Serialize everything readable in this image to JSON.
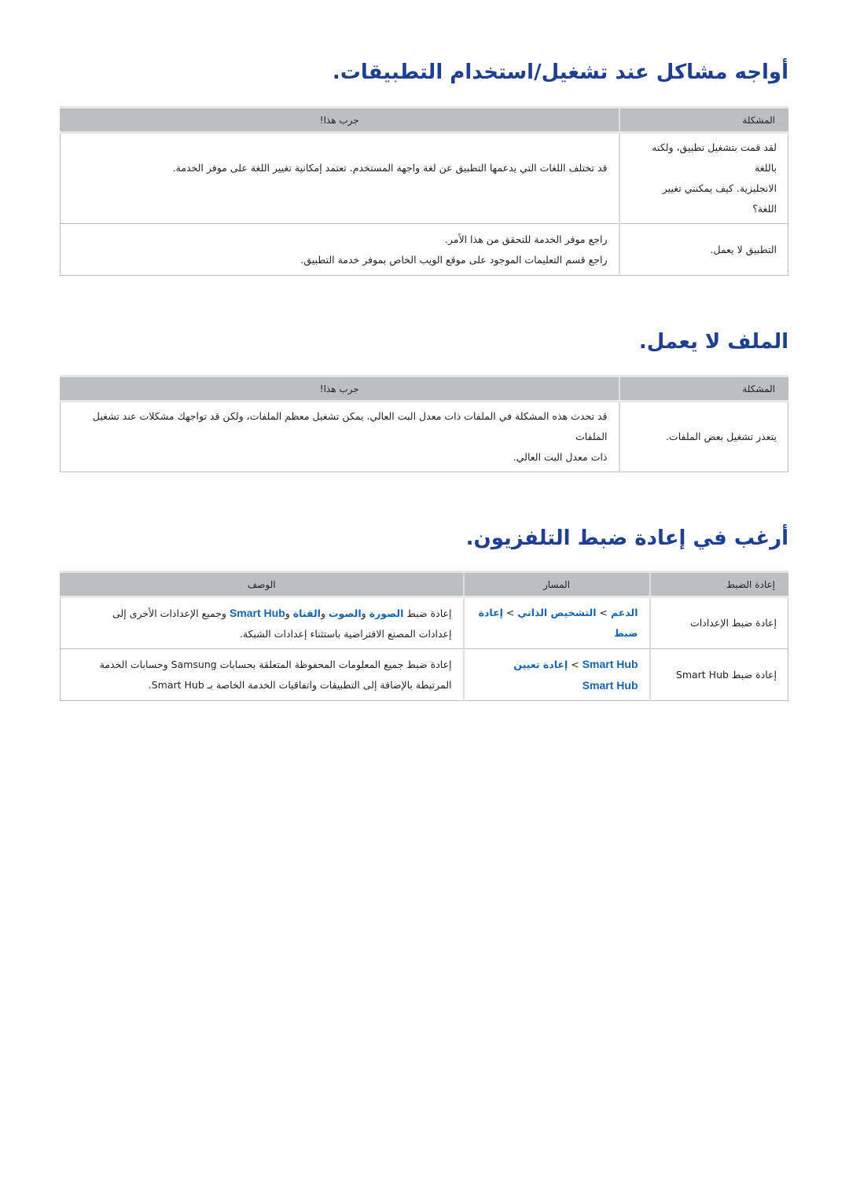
{
  "sections": [
    {
      "title": "أواجه مشاكل عند تشغيل/استخدام التطبيقات.",
      "headers": [
        "المشكلة",
        "جرب هذا!"
      ],
      "rows": [
        {
          "problem": [
            "لقد قمت بتشغيل تطبيق، ولكنه باللغة",
            "الانجليزية. كيف يمكنني تغيير",
            "اللغة؟"
          ],
          "solution": [
            "قد تختلف اللغات التي يدعمها التطبيق عن لغة واجهة المستخدم. تعتمد إمكانية تغيير اللغة على موفر الخدمة."
          ]
        },
        {
          "problem": [
            "التطبيق لا يعمل."
          ],
          "solution": [
            "راجع موفر الخدمة للتحقق من هذا الأمر.",
            "راجع قسم التعليمات الموجود على موقع الويب الخاص بموفر خدمة التطبيق."
          ]
        }
      ]
    },
    {
      "title": "الملف لا يعمل.",
      "headers": [
        "المشكلة",
        "جرب هذا!"
      ],
      "rows": [
        {
          "problem": [
            "يتعذر تشغيل بعض الملفات."
          ],
          "solution": [
            "قد تحدث هذه المشكلة في الملفات ذات معدل البت العالي. يمكن تشغيل معظم الملفات، ولكن قد تواجهك مشكلات عند تشغيل الملفات",
            "ذات معدل البت العالي."
          ]
        }
      ]
    },
    {
      "title": "أرغب في إعادة ضبط التلفزيون.",
      "headers": [
        "إعادة الضبط",
        "المسار",
        "الوصف"
      ],
      "rows": [
        {
          "reset": "إعادة ضبط الإعدادات",
          "path": {
            "support": "الدعم",
            "self_diagnosis": "التشخيص الذاتي",
            "reset": "إعادة ضبط",
            "separator": ">"
          },
          "description": {
            "prefix": "إعادة ضبط",
            "picture": "الصورة",
            "and1": "و",
            "sound": "الصوت",
            "and2": "و",
            "channel": "القناة",
            "and3": "و",
            "smart_hub": "Smart Hub",
            "rest": "وجميع الإعدادات الأخرى إلى",
            "line2": "إعدادات المصنع الافتراضية باستثناء إعدادات الشبكة."
          }
        },
        {
          "reset": "إعادة ضبط Smart Hub",
          "path": {
            "smart_hub": "Smart Hub",
            "reset": "إعادة تعيين",
            "smart_hub_2": "Smart Hub",
            "separator": ">"
          },
          "description": {
            "line1": "إعادة ضبط جميع المعلومات المحفوظة المتعلقة بحسابات Samsung وحسابات الخدمة",
            "line2": "المرتبطة بالإضافة إلى التطبيقات واتفاقيات الخدمة الخاصة بـ Smart Hub."
          }
        }
      ]
    }
  ]
}
